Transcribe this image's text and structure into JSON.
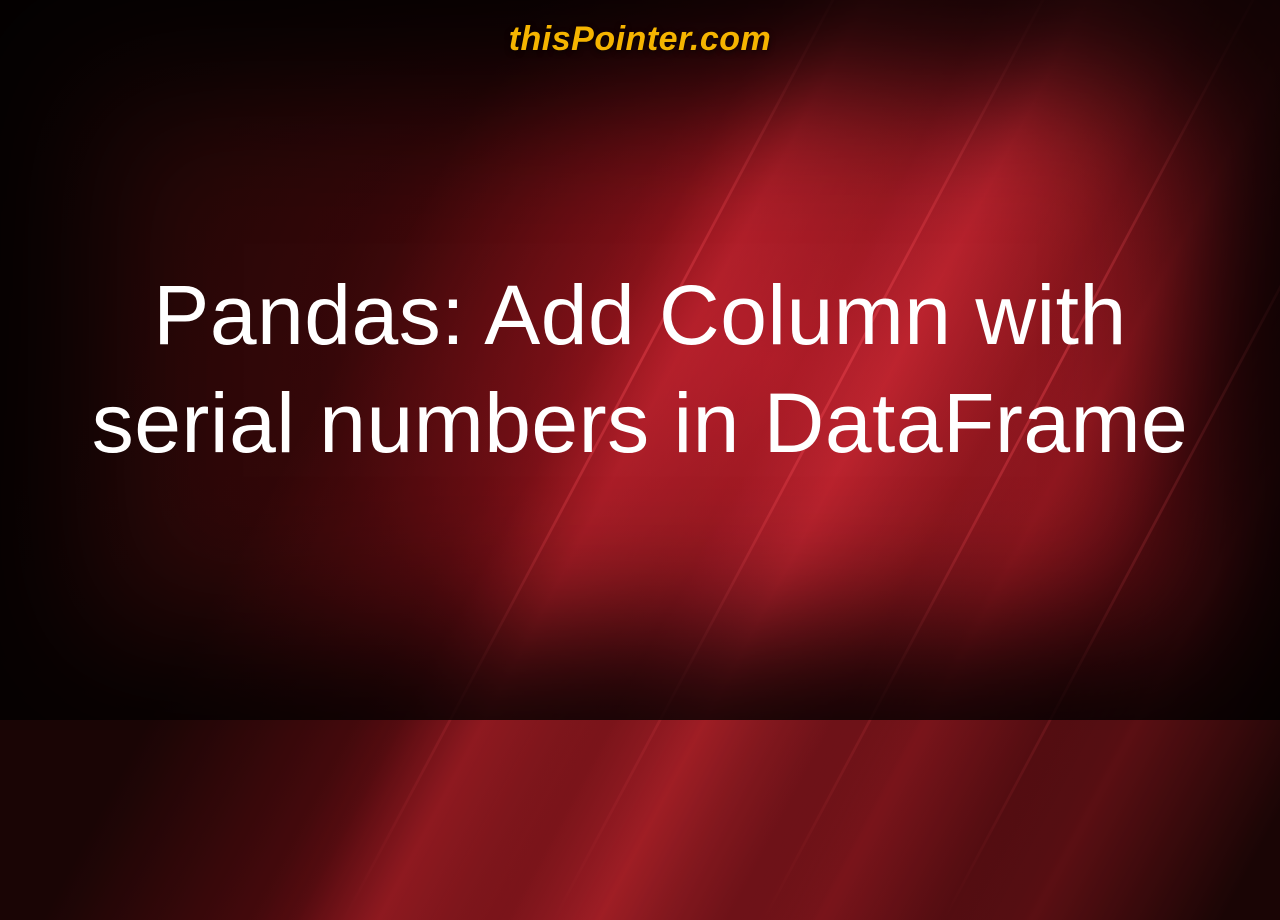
{
  "brand": "thisPointer.com",
  "heading": "Pandas: Add Column with serial numbers in DataFrame"
}
